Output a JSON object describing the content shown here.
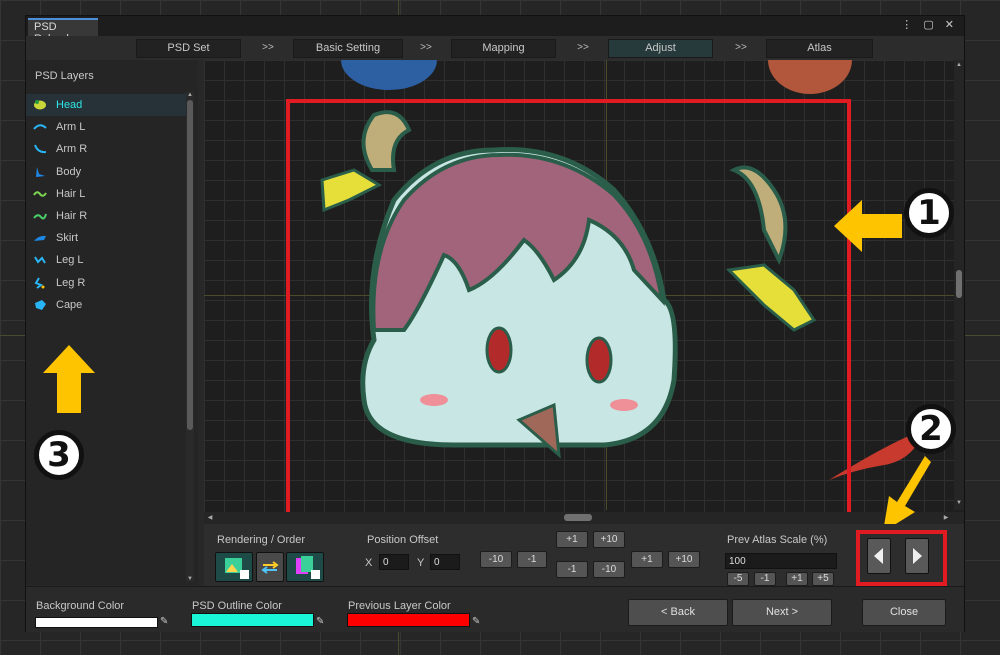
{
  "window": {
    "tab_title": "PSD Reload",
    "menu_glyph": "⋮",
    "maximize_glyph": "▢",
    "close_glyph": "✕"
  },
  "steps": [
    {
      "label": "PSD Set"
    },
    {
      "label": "Basic Setting"
    },
    {
      "label": "Mapping"
    },
    {
      "label": "Adjust",
      "active": true
    },
    {
      "label": "Atlas"
    }
  ],
  "step_separator": ">>",
  "layers_panel": {
    "title": "PSD Layers",
    "items": [
      {
        "label": "Head",
        "selected": true
      },
      {
        "label": "Arm L"
      },
      {
        "label": "Arm R"
      },
      {
        "label": "Body"
      },
      {
        "label": "Hair L"
      },
      {
        "label": "Hair R"
      },
      {
        "label": "Skirt"
      },
      {
        "label": "Leg L"
      },
      {
        "label": "Leg R"
      },
      {
        "label": "Cape"
      }
    ]
  },
  "controls": {
    "rendering_label": "Rendering / Order",
    "position_label": "Position Offset",
    "x_label": "X",
    "x_value": "0",
    "y_label": "Y",
    "y_value": "0",
    "offset_buttons": {
      "x_minus10": "-10",
      "x_minus1": "-1",
      "y_plus1": "+1",
      "y_plus10": "+10",
      "y_minus1": "-1",
      "y_minus10": "-10",
      "x_plus1": "+1",
      "x_plus10": "+10"
    },
    "scale_label": "Prev Atlas Scale (%)",
    "scale_value": "100",
    "scale_buttons": {
      "minus5": "-5",
      "minus1": "-1",
      "plus1": "+1",
      "plus5": "+5"
    },
    "prev_glyph": "◀",
    "next_glyph": "▶"
  },
  "footer": {
    "bg_color_label": "Background Color",
    "outline_color_label": "PSD Outline Color",
    "prev_layer_color_label": "Previous Layer Color",
    "back_label": "< Back",
    "next_label": "Next >",
    "close_label": "Close",
    "bg_color": "#ffffff",
    "outline_color": "#1af5d8",
    "prev_layer_color": "#ff0000"
  },
  "callouts": {
    "one": "1",
    "two": "2",
    "three": "3"
  },
  "colors": {
    "accent_cyan": "#2ee7e7",
    "highlight_red": "#e01b22",
    "arrow_yellow": "#ffc400",
    "active_tab_blue": "#4f8fd9"
  }
}
